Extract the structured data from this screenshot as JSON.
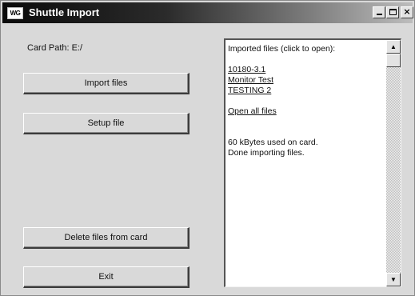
{
  "window": {
    "title": "Shuttle Import",
    "app_icon_text": "WG",
    "minimize_icon": "minimize-icon",
    "maximize_icon": "maximize-icon",
    "close_icon": "close-icon",
    "close_glyph": "×"
  },
  "left": {
    "card_path": "Card Path: E:/",
    "buttons": {
      "import": "Import files",
      "setup": "Setup file",
      "delete": "Delete files from card",
      "exit": "Exit"
    }
  },
  "list": {
    "header": "Imported files (click to open):",
    "files": [
      "10180-3.1",
      "Monitor Test",
      "TESTING 2"
    ],
    "open_all": "Open all files",
    "status_lines": [
      "60 kBytes used on card.",
      "Done importing files."
    ],
    "scroll_up_glyph": "▲",
    "scroll_down_glyph": "▼"
  }
}
